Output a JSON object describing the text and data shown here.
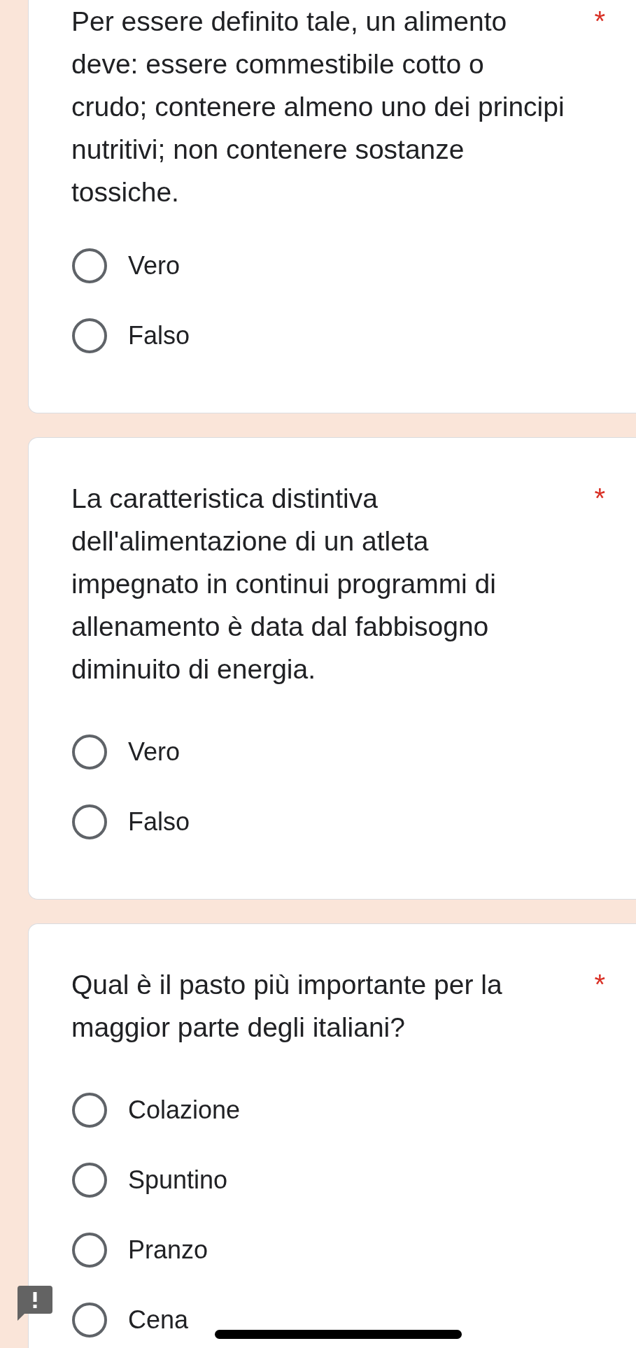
{
  "questions": [
    {
      "text": "Per essere definito tale, un alimento deve: essere commestibile cotto o crudo; contenere almeno uno dei principi nutritivi; non contenere sostanze tossiche.",
      "required_mark": "*",
      "options": [
        {
          "label": "Vero",
          "selected": false
        },
        {
          "label": "Falso",
          "selected": false
        }
      ]
    },
    {
      "text": "La caratteristica distintiva dell'alimentazione di un atleta impegnato in continui programmi di allenamento è data dal fabbisogno diminuito di energia.",
      "required_mark": "*",
      "options": [
        {
          "label": "Vero",
          "selected": false
        },
        {
          "label": "Falso",
          "selected": false
        }
      ]
    },
    {
      "text": "Qual è il pasto più importante per la maggior parte degli italiani?",
      "required_mark": "*",
      "options": [
        {
          "label": "Colazione",
          "selected": false
        },
        {
          "label": "Spuntino",
          "selected": false
        },
        {
          "label": "Pranzo",
          "selected": false
        },
        {
          "label": "Cena",
          "selected": false
        }
      ]
    }
  ]
}
